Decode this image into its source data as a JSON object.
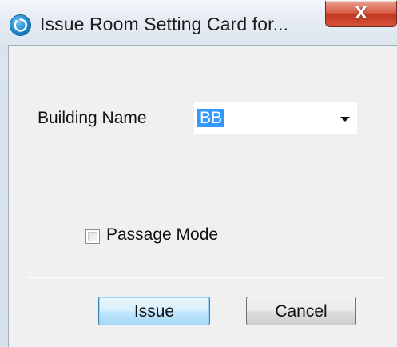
{
  "window": {
    "title": "Issue Room Setting Card for...",
    "close_label": "X",
    "icon": "app-logo-icon"
  },
  "form": {
    "building_label": "Building Name",
    "building_value": "BB",
    "passage_mode_label": "Passage Mode",
    "passage_mode_checked": false
  },
  "buttons": {
    "issue_label": "Issue",
    "cancel_label": "Cancel"
  }
}
